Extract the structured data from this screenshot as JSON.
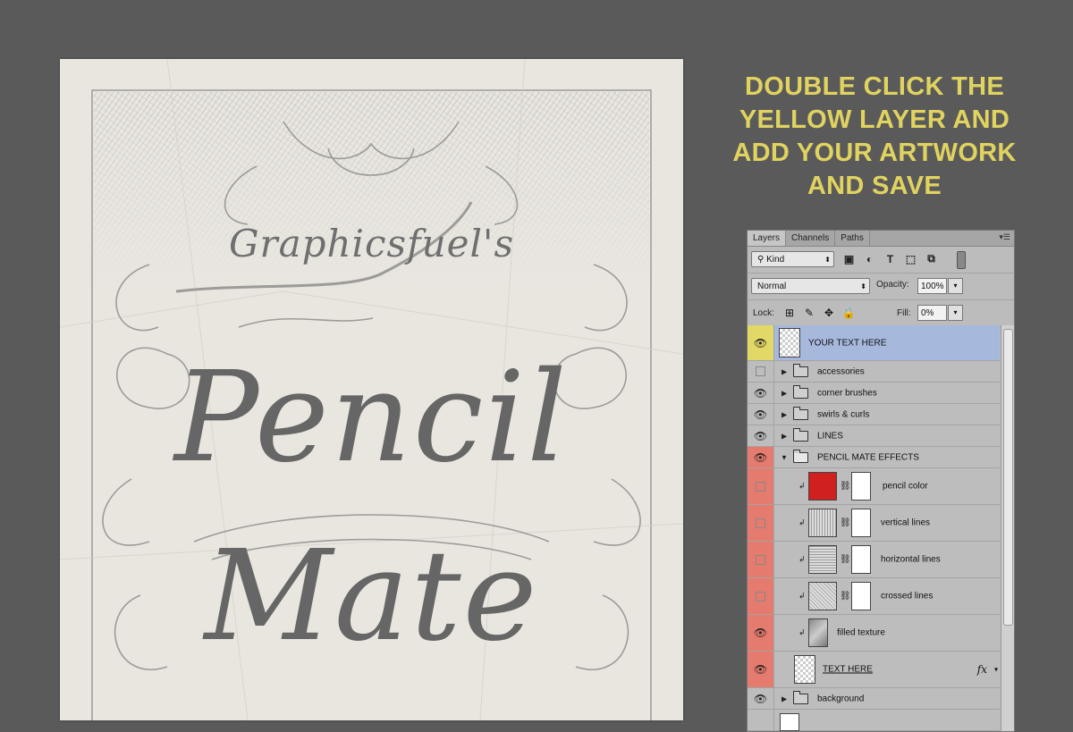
{
  "poster": {
    "subtitle": "Graphicsfuel's",
    "title_line1": "Pencil",
    "title_line2": "Mate"
  },
  "instruction": {
    "line1": "DOUBLE CLICK THE",
    "line2": "YELLOW LAYER AND",
    "line3": "ADD YOUR ARTWORK",
    "line4": "AND SAVE",
    "color": "#e0d360"
  },
  "panel": {
    "tabs": [
      {
        "label": "Layers",
        "active": true
      },
      {
        "label": "Channels",
        "active": false
      },
      {
        "label": "Paths",
        "active": false
      }
    ],
    "filter": {
      "kind_label": "Kind"
    },
    "blend": {
      "mode": "Normal",
      "opacity_label": "Opacity:",
      "opacity": "100%"
    },
    "lock": {
      "label": "Lock:",
      "fill_label": "Fill:",
      "fill": "0%"
    },
    "layers": [
      {
        "name": "YOUR TEXT HERE",
        "visible": true,
        "vis_color": "#e2d867",
        "selected": true,
        "type": "smart"
      },
      {
        "name": "accessories",
        "visible": false,
        "vis_color": "#bdbdbd",
        "type": "group"
      },
      {
        "name": "corner brushes",
        "visible": true,
        "vis_color": "#bdbdbd",
        "type": "group"
      },
      {
        "name": "swirls & curls",
        "visible": true,
        "vis_color": "#bdbdbd",
        "type": "group"
      },
      {
        "name": "LINES",
        "visible": true,
        "vis_color": "#bdbdbd",
        "type": "group"
      },
      {
        "name": "PENCIL MATE EFFECTS",
        "visible": true,
        "vis_color": "#e57b6e",
        "type": "group-open"
      },
      {
        "name": "pencil color",
        "visible": false,
        "vis_color": "#e57b6e",
        "type": "fill-adjust",
        "thumb_color": "#d0201f"
      },
      {
        "name": "vertical lines",
        "visible": false,
        "vis_color": "#e57b6e",
        "type": "pattern-adjust"
      },
      {
        "name": "horizontal lines",
        "visible": false,
        "vis_color": "#e57b6e",
        "type": "pattern-adjust"
      },
      {
        "name": "crossed lines",
        "visible": false,
        "vis_color": "#e57b6e",
        "type": "pattern-adjust"
      },
      {
        "name": "filled texture",
        "visible": true,
        "vis_color": "#e57b6e",
        "type": "smart-clip"
      },
      {
        "name": "TEXT HERE",
        "visible": true,
        "vis_color": "#e57b6e",
        "type": "smart-fx",
        "fx": "fx"
      },
      {
        "name": "background",
        "visible": true,
        "vis_color": "#bdbdbd",
        "type": "group"
      },
      {
        "name": "",
        "visible": false,
        "vis_color": "#bdbdbd",
        "type": "blank"
      }
    ]
  }
}
